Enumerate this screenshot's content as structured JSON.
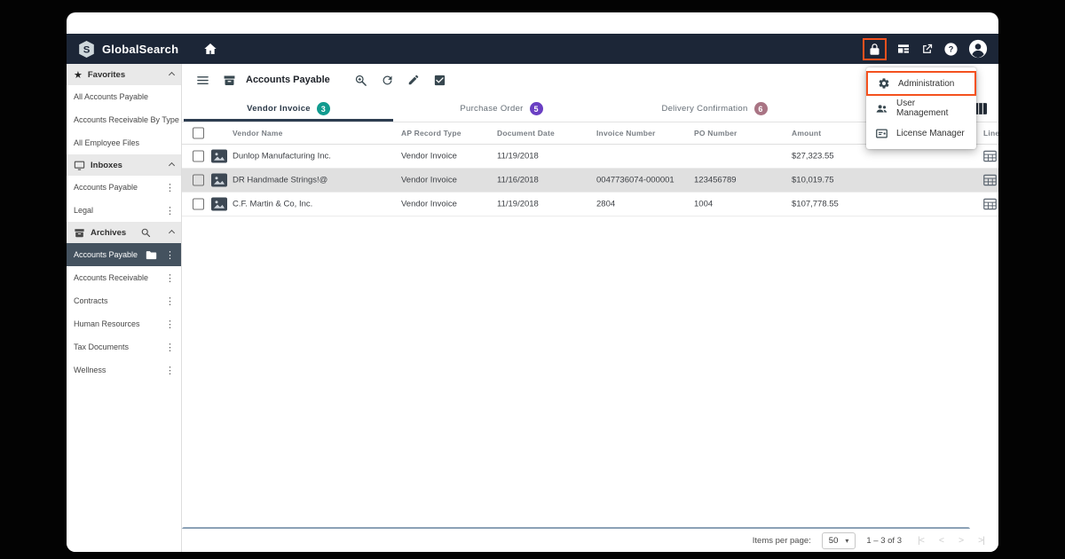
{
  "brand": {
    "name": "GlobalSearch",
    "logo_letter": "S"
  },
  "icons": {
    "star": "★",
    "kebab": "⋮",
    "caret_down": "▾",
    "help": "?",
    "page_first": "|<",
    "page_prev": "<",
    "page_next": ">",
    "page_last": ">|"
  },
  "colors": {
    "appbar_bg": "#1c2637",
    "annotation_red": "#f4511e",
    "selected_row_bg": "#e0e0e0",
    "selected_sidebar_bg": "#44525f",
    "scrollbar": "#8ba1b6",
    "tab_active_underline": "#2d3d50"
  },
  "account_menu": {
    "items": [
      {
        "label": "Administration",
        "annotated": true
      },
      {
        "label": "User Management",
        "annotated": false
      },
      {
        "label": "License Manager",
        "annotated": false
      }
    ]
  },
  "sidebar": {
    "favorites": {
      "title": "Favorites",
      "items": [
        "All Accounts Payable",
        "Accounts Receivable By Type",
        "All Employee Files"
      ]
    },
    "inboxes": {
      "title": "Inboxes",
      "items": [
        "Accounts Payable",
        "Legal"
      ]
    },
    "archives": {
      "title": "Archives",
      "items": [
        "Accounts Payable",
        "Accounts Receivable",
        "Contracts",
        "Human Resources",
        "Tax Documents",
        "Wellness"
      ],
      "selected_item": "Accounts Payable"
    }
  },
  "toolbar": {
    "title": "Accounts Payable"
  },
  "tabs": [
    {
      "label": "Vendor Invoice",
      "count": "3",
      "badge_color": "#119b8f",
      "active": true
    },
    {
      "label": "Purchase Order",
      "count": "5",
      "badge_color": "#6a3fc3",
      "active": false
    },
    {
      "label": "Delivery Confirmation",
      "count": "6",
      "badge_color": "#a97484",
      "active": false
    }
  ],
  "table": {
    "columns": [
      "Vendor Name",
      "AP Record Type",
      "Document Date",
      "Invoice Number",
      "PO Number",
      "Amount",
      "Line Item"
    ],
    "rows": [
      {
        "vendor_name": "Dunlop Manufacturing Inc.",
        "ap_record_type": "Vendor Invoice",
        "document_date": "11/19/2018",
        "invoice_number": "",
        "po_number": "",
        "amount": "$27,323.55"
      },
      {
        "vendor_name": "DR Handmade Strings!@",
        "ap_record_type": "Vendor Invoice",
        "document_date": "11/16/2018",
        "invoice_number": "0047736074-000001",
        "po_number": "123456789",
        "amount": "$10,019.75"
      },
      {
        "vendor_name": "C.F. Martin & Co, Inc.",
        "ap_record_type": "Vendor Invoice",
        "document_date": "11/19/2018",
        "invoice_number": "2804",
        "po_number": "1004",
        "amount": "$107,778.55"
      }
    ]
  },
  "pagination": {
    "items_per_page_label": "Items per page:",
    "items_per_page_value": "50",
    "range_text": "1 – 3 of 3"
  }
}
